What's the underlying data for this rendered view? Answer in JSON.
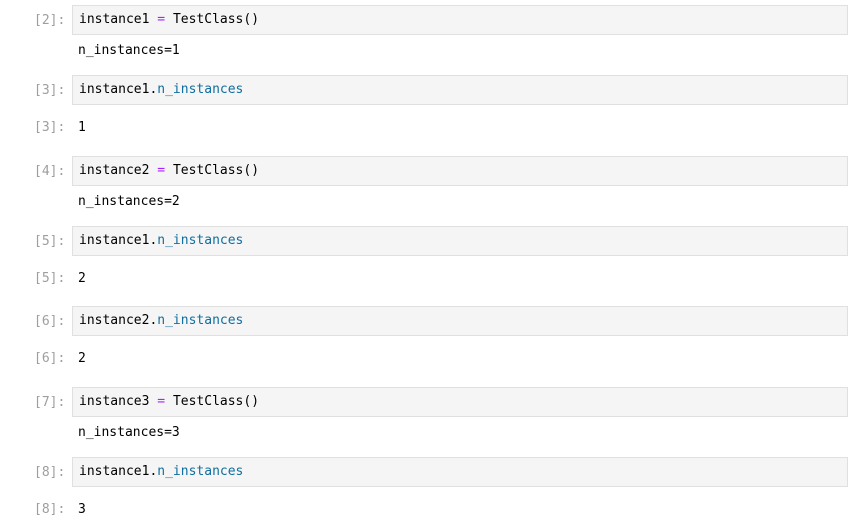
{
  "cells": [
    {
      "in_prompt": "[2]:",
      "code": {
        "var": "instance1",
        "op": "=",
        "call": "TestClass()"
      },
      "stdout": "n_instances=1"
    },
    {
      "in_prompt": "[3]:",
      "code": {
        "obj": "instance1",
        "dot": ".",
        "attr": "n_instances"
      },
      "out_prompt": "[3]:",
      "result": "1"
    },
    {
      "in_prompt": "[4]:",
      "code": {
        "var": "instance2",
        "op": "=",
        "call": "TestClass()"
      },
      "stdout": "n_instances=2"
    },
    {
      "in_prompt": "[5]:",
      "code": {
        "obj": "instance1",
        "dot": ".",
        "attr": "n_instances"
      },
      "out_prompt": "[5]:",
      "result": "2"
    },
    {
      "in_prompt": "[6]:",
      "code": {
        "obj": "instance2",
        "dot": ".",
        "attr": "n_instances"
      },
      "out_prompt": "[6]:",
      "result": "2"
    },
    {
      "in_prompt": "[7]:",
      "code": {
        "var": "instance3",
        "op": "=",
        "call": "TestClass()"
      },
      "stdout": "n_instances=3"
    },
    {
      "in_prompt": "[8]:",
      "code": {
        "obj": "instance1",
        "dot": ".",
        "attr": "n_instances"
      },
      "out_prompt": "[8]:",
      "result": "3"
    }
  ]
}
